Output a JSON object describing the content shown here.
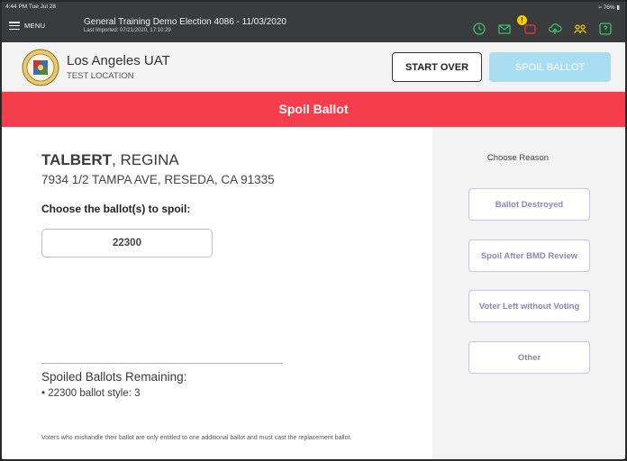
{
  "status_bar": {
    "time": "4:44 PM  Tue Jul 28",
    "battery": "76%"
  },
  "app_bar": {
    "menu_label": "MENU",
    "election_title": "General Training  Demo Election 4086 - 11/03/2020",
    "last_imported": "Last Imported: 07/21/2020, 17:10:29",
    "icons": [
      "history-icon",
      "mail-icon",
      "notification-icon",
      "cloud-icon",
      "users-icon",
      "help-icon"
    ],
    "notification_count": "!"
  },
  "org_header": {
    "name": "Los Angeles UAT",
    "location": "TEST LOCATION",
    "start_over_label": "START OVER",
    "spoil_ballot_label": "SPOIL BALLOT"
  },
  "page_title": "Spoil Ballot",
  "voter": {
    "last_name": "TALBERT",
    "first_name": ", REGINA",
    "address": "7934 1/2 TAMPA AVE, RESEDA, CA 91335"
  },
  "ballot_selection": {
    "label": "Choose the ballot(s) to spoil:",
    "ballots": [
      "22300"
    ]
  },
  "spoiled_remaining": {
    "title": "Spoiled Ballots Remaining:",
    "items": [
      "• 22300 ballot style: 3"
    ]
  },
  "disclaimer": "Voters who mishandle their ballot are only entitled to one additional ballot and must cast the replacement ballot.",
  "reasons": {
    "heading": "Choose Reason",
    "options": [
      "Ballot Destroyed",
      "Spoil After BMD Review",
      "Voter Left without Voting",
      "Other"
    ]
  },
  "colors": {
    "banner": "#f53d4c",
    "topbar": "#3a3b3d",
    "accent_disabled": "#a9ddf1",
    "reason_text": "#8a86b8",
    "icon_green": "#3cc46a",
    "icon_red": "#e5333f"
  }
}
